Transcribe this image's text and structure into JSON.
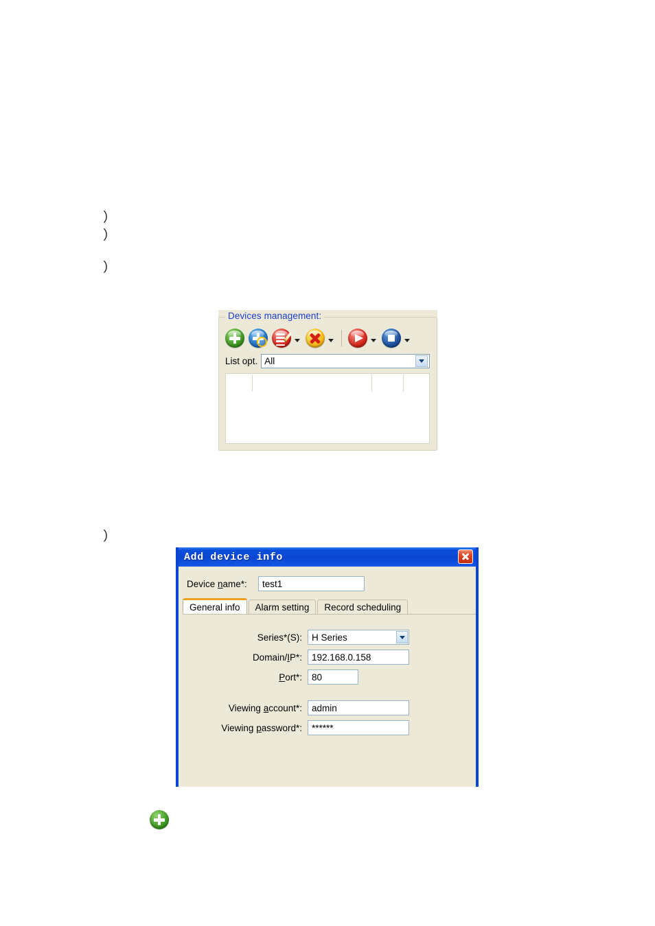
{
  "document": {
    "list_markers": [
      "）",
      "）",
      "）",
      "）"
    ]
  },
  "devices_panel": {
    "legend": "Devices management:",
    "toolbar": [
      {
        "name": "add-device",
        "icon": "green-plus-icon",
        "has_dropdown": false
      },
      {
        "name": "search-add-device",
        "icon": "blue-plus-magnifier-icon",
        "has_dropdown": false
      },
      {
        "name": "edit-device",
        "icon": "red-edit-list-icon",
        "has_dropdown": true
      },
      {
        "name": "delete-device",
        "icon": "yellow-x-delete-icon",
        "has_dropdown": true
      },
      {
        "name": "play-device",
        "icon": "red-play-icon",
        "has_dropdown": true
      },
      {
        "name": "stop-device",
        "icon": "blue-stop-icon",
        "has_dropdown": true
      }
    ],
    "list_opt": {
      "label": "List opt.",
      "value": "All",
      "options": [
        "All"
      ]
    },
    "device_list": {
      "rows": [],
      "column_separators": [
        38,
        328,
        380
      ]
    }
  },
  "add_device_dialog": {
    "title": "Add device info",
    "close_label": "✕",
    "device_name": {
      "label_prefix": "Device ",
      "label_accel": "n",
      "label_suffix": "ame*:",
      "value": "test1"
    },
    "tabs": [
      {
        "label": "General info",
        "active": true
      },
      {
        "label": "Alarm setting",
        "active": false
      },
      {
        "label": "Record scheduling",
        "active": false
      }
    ],
    "general_info": {
      "series": {
        "label": "Series*(S):",
        "value": "H Series",
        "options": [
          "H Series"
        ]
      },
      "domain_ip": {
        "label_prefix": "Domain/",
        "label_accel": "I",
        "label_suffix": "P*:",
        "value": "192.168.0.158"
      },
      "port": {
        "label_prefix": "",
        "label_accel": "P",
        "label_suffix": "ort*:",
        "value": "80"
      },
      "viewing_account": {
        "label_prefix": "Viewing ",
        "label_accel": "a",
        "label_suffix": "ccount*:",
        "value": "admin"
      },
      "viewing_password": {
        "label_prefix": "Viewing ",
        "label_accel": "p",
        "label_suffix": "assword*:",
        "value": "******"
      }
    }
  },
  "footer_icon": {
    "name": "green-add-icon",
    "color": "#3f9624"
  }
}
